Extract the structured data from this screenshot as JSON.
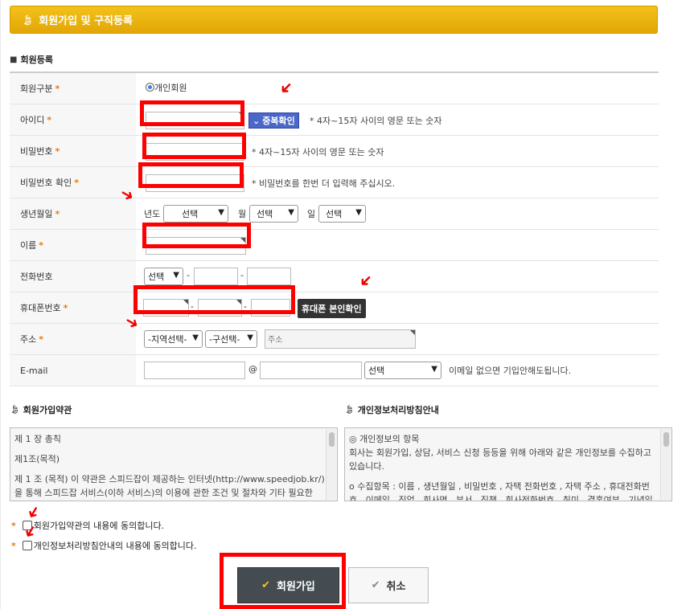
{
  "header": {
    "title": "회원가입 및 구직등록",
    "icon": "leaf-icon"
  },
  "section": {
    "title": "회원등록",
    "icon": "person-icon"
  },
  "form": {
    "member_type": {
      "label": "회원구분",
      "option": "개인회원"
    },
    "userid": {
      "label": "아이디",
      "check_button": "중복확인",
      "hint": "* 4자~15자 사이의 영문 또는 숫자"
    },
    "password": {
      "label": "비밀번호",
      "hint": "* 4자~15자 사이의 영문 또는 숫자"
    },
    "password_confirm": {
      "label": "비밀번호 확인",
      "hint": "* 비밀번호를 한번 더 입력해 주십시오."
    },
    "birth": {
      "label": "생년월일",
      "year_label": "년도",
      "month_label": "월",
      "day_label": "일",
      "year_value": "선택",
      "month_value": "선택",
      "day_value": "선택"
    },
    "name": {
      "label": "이름"
    },
    "phone": {
      "label": "전화번호",
      "prefix_value": "선택",
      "dash": "-"
    },
    "mobile": {
      "label": "휴대폰번호",
      "verify_button": "휴대폰 본인확인",
      "dash": "-"
    },
    "address": {
      "label": "주소",
      "region_value": "-지역선택-",
      "district_value": "-구선택-",
      "placeholder": "주소"
    },
    "email": {
      "label": "E-mail",
      "at": "@",
      "domain_value": "선택",
      "note": "이메일 없으면 기입안해도됩니다."
    },
    "required_mark": "*"
  },
  "terms": {
    "title": "회원가입약관",
    "lines": [
      "제 1 장 총칙",
      "제1조(목적)",
      "제 1 조 (목적) 이 약관은 스피드잡이 제공하는 인터넷(http://www.speedjob.kr/)",
      "을 통해  스피드잡 서비스(이하 서비스)의 이용에 관한 조건 및 절차와 기타 필요한"
    ]
  },
  "privacy": {
    "title": "개인정보처리방침안내",
    "lines": [
      "◎ 개인정보의 항목",
      "회사는 회원가입, 상담, 서비스 신청 등등을 위해 아래와 같은 개인정보를 수집하고",
      "있습니다.",
      "o 수집항목 : 이름 , 생년월일 , 비밀번호 , 자택 전화번호 , 자택 주소 , 휴대전화번",
      "호 , 이메일 , 직업 , 회사명 , 부서 , 직책 , 회사전화번호 , 취미 , 결혼여부 , 기념일 ,"
    ]
  },
  "agreements": {
    "terms_label": "회원가입약관의 내용에 동의합니다.",
    "privacy_label": "개인정보처리방침안내의 내용에 동의합니다.",
    "mark": "*"
  },
  "buttons": {
    "join": "회원가입",
    "cancel": "취소"
  }
}
